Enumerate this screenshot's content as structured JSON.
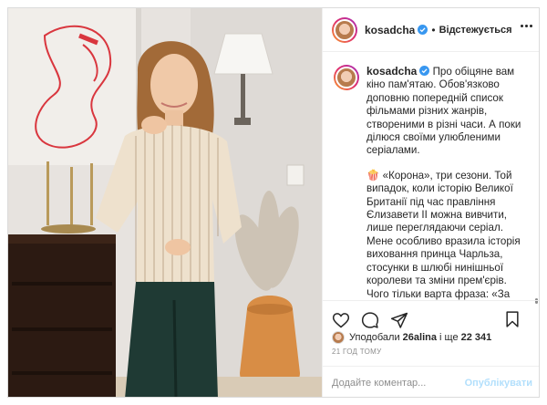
{
  "post": {
    "username": "kosadcha",
    "follow_label": "Відстежується",
    "separator": "•",
    "caption": {
      "intro": "Про обіцяне вам кіно пам'ятаю. Обов'язково доповню попередній список фільмами різних жанрів, створеними в різні часи. А поки ділюся своїми улюбленими серіалами.",
      "para2": "🍿 «Корона», три сезони. Той випадок, коли історію Великої Британії під час правління Єлизавети II можна вивчити, лише переглядаючи серіал. Мене особливо вразила історія виховання принца Чарльза, стосунки в шлюбі нинішньої королеви та зміни прем'єрів. Чого тільки варта фраза: «За час мого правління ви вже п'ятий прем'єр. Ви всі хворієте, втомлюєтеся, не хочете нести відповідальність... А я ні»"
    },
    "likes": {
      "prefix": "Уподобали",
      "liker": "26alina",
      "middle": "і ще",
      "count": "22 341"
    },
    "time": "21 ГОД ТОМУ",
    "comment": {
      "placeholder": "Додайте коментар...",
      "publish_label": "Опублікувати"
    },
    "colors": {
      "verified": "#3897f0",
      "publish_disabled": "#b2dffc"
    }
  }
}
